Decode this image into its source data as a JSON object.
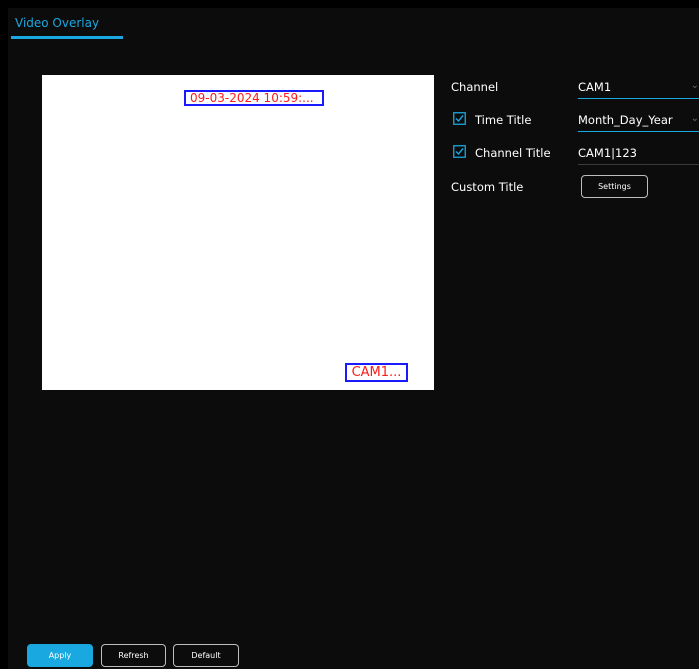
{
  "tab": {
    "label": "Video Overlay"
  },
  "preview": {
    "time_overlay": "09-03-2024 10:59:...",
    "channel_overlay": "CAM1..."
  },
  "settings": {
    "channel": {
      "label": "Channel",
      "value": "CAM1"
    },
    "time_title": {
      "label": "Time Title",
      "checked": true,
      "value": "Month_Day_Year"
    },
    "channel_title": {
      "label": "Channel Title",
      "checked": true,
      "value": "CAM1|123"
    },
    "custom_title": {
      "label": "Custom Title",
      "button": "Settings"
    }
  },
  "footer": {
    "apply": "Apply",
    "refresh": "Refresh",
    "default": "Default"
  },
  "colors": {
    "accent": "#1aa8e0",
    "overlay_text": "#ff1a1a",
    "overlay_border": "#1a1aff"
  }
}
